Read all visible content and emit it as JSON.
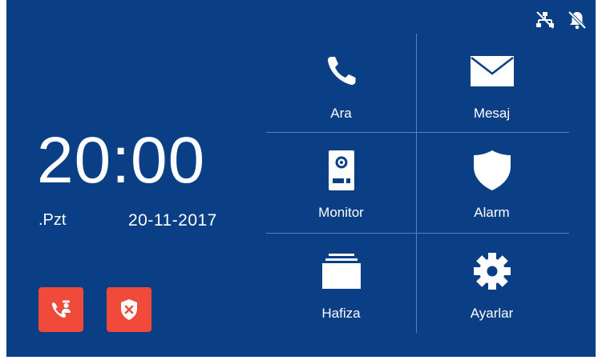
{
  "status": {
    "icons": [
      "network-disconnected-icon",
      "bell-muted-icon"
    ]
  },
  "clock": {
    "time": "20:00",
    "day": ".Pzt",
    "date": "20-11-2017"
  },
  "quick_actions": [
    {
      "icon": "call-guard-icon",
      "color": "#f04a3a"
    },
    {
      "icon": "shield-cancel-icon",
      "color": "#f04a3a"
    }
  ],
  "menu": {
    "items": [
      {
        "label": "Ara",
        "icon": "phone-icon"
      },
      {
        "label": "Mesaj",
        "icon": "envelope-icon"
      },
      {
        "label": "Monitor",
        "icon": "door-station-icon"
      },
      {
        "label": "Alarm",
        "icon": "shield-icon"
      },
      {
        "label": "Hafiza",
        "icon": "folder-stack-icon"
      },
      {
        "label": "Ayarlar",
        "icon": "gear-icon"
      }
    ]
  },
  "colors": {
    "background": "#0a3f86",
    "accent": "#f04a3a",
    "divider": "#5a81b3"
  }
}
